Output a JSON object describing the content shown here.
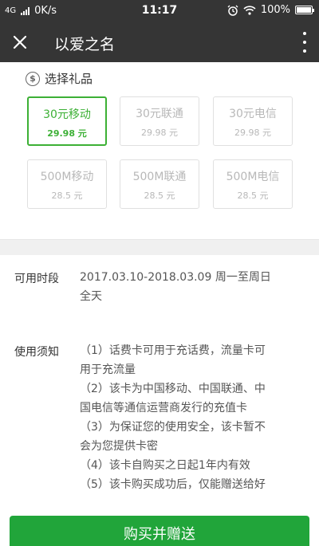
{
  "status_bar": {
    "network": "4G",
    "speed": "0K/s",
    "time": "11:17",
    "battery": "100%"
  },
  "nav": {
    "title": "以爱之名"
  },
  "gift": {
    "header": "选择礼品",
    "items": [
      {
        "name": "30元移动",
        "price": "29.98 元",
        "selected": true
      },
      {
        "name": "30元联通",
        "price": "29.98 元",
        "selected": false
      },
      {
        "name": "30元电信",
        "price": "29.98 元",
        "selected": false
      },
      {
        "name": "500M移动",
        "price": "28.5 元",
        "selected": false
      },
      {
        "name": "500M联通",
        "price": "28.5 元",
        "selected": false
      },
      {
        "name": "500M电信",
        "price": "28.5 元",
        "selected": false
      }
    ]
  },
  "availability": {
    "label": "可用时段",
    "lines": [
      "2017.03.10-2018.03.09 周一至周日",
      "全天"
    ]
  },
  "notes": {
    "label": "使用须知",
    "lines": [
      "（1）话费卡可用于充话费，流量卡可",
      "用于充流量",
      "（2）该卡为中国移动、中国联通、中",
      "国电信等通信运营商发行的充值卡",
      "（3）为保证您的使用安全，该卡暂不",
      "会为您提供卡密",
      "（4）该卡自购买之日起1年内有效",
      "（5）该卡购买成功后，仅能赠送给好"
    ]
  },
  "actions": {
    "buy_label": "购买并赠送"
  },
  "colors": {
    "accent": "#3cb035",
    "button": "#21a53a",
    "header_bg": "#353535"
  }
}
